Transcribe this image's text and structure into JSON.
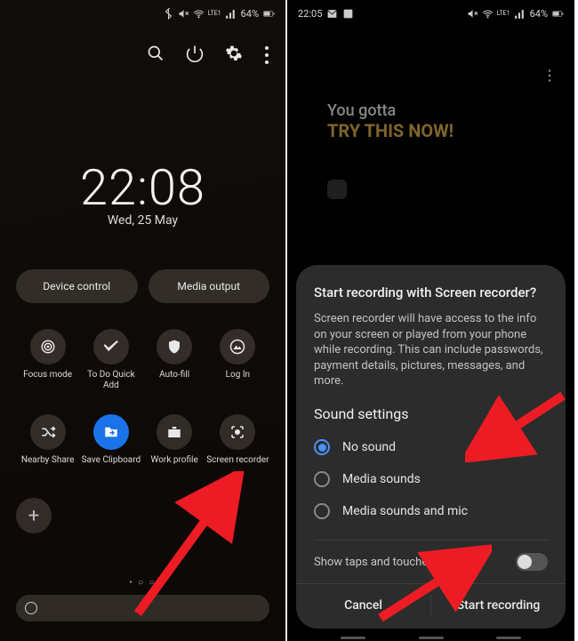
{
  "status": {
    "time_right": "22:05",
    "battery": "64%",
    "signal_label": "LTE1"
  },
  "screen1": {
    "clock_time": "22:08",
    "clock_date": "Wed, 25 May",
    "pills": {
      "device_control": "Device control",
      "media_output": "Media output"
    },
    "tiles": [
      {
        "label": "Focus mode",
        "icon": "target-icon"
      },
      {
        "label": "To Do Quick Add",
        "icon": "check-icon"
      },
      {
        "label": "Auto-fill",
        "icon": "shield-icon"
      },
      {
        "label": "Log In",
        "icon": "mountain-icon"
      },
      {
        "label": "Nearby Share",
        "icon": "shuffle-icon"
      },
      {
        "label": "Save Clipboard",
        "icon": "folder-icon",
        "active": true
      },
      {
        "label": "Work profile",
        "icon": "briefcase-icon"
      },
      {
        "label": "Screen recorder",
        "icon": "record-icon"
      }
    ],
    "page_dots": "• ○ ○"
  },
  "screen2": {
    "hero_line1": "You gotta",
    "hero_line2": "TRY THIS NOW!",
    "dialog": {
      "title": "Start recording with Screen recorder?",
      "desc": "Screen recorder will have access to the info on your screen or played from your phone while recording. This can include passwords, payment details, pictures, messages, and more.",
      "sound_heading": "Sound settings",
      "options": {
        "no_sound": "No sound",
        "media": "Media sounds",
        "media_mic": "Media sounds and mic"
      },
      "selected": "no_sound",
      "show_taps": "Show taps and touches",
      "cancel": "Cancel",
      "start": "Start recording"
    }
  },
  "arrow_color": "#ed1c24"
}
